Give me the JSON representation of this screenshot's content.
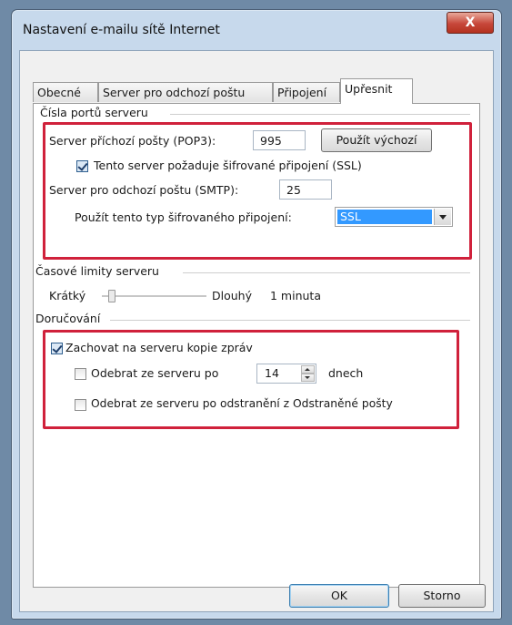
{
  "window": {
    "title": "Nastavení e-mailu sítě Internet",
    "close_label": "X"
  },
  "tabs": [
    {
      "label": "Obecné",
      "active": false
    },
    {
      "label": "Server pro odchozí poštu",
      "active": false
    },
    {
      "label": "Připojení",
      "active": false
    },
    {
      "label": "Upřesnit",
      "active": true
    }
  ],
  "ports": {
    "group_title": "Čísla portů serveru",
    "incoming_label": "Server příchozí pošty (POP3):",
    "incoming_value": "995",
    "default_button": "Použít výchozí",
    "ssl_checkbox_label": "Tento server požaduje šifrované připojení (SSL)",
    "ssl_checked": true,
    "outgoing_label": "Server pro odchozí poštu (SMTP):",
    "outgoing_value": "25",
    "encryption_label": "Použít tento typ šifrovaného připojení:",
    "encryption_value": "SSL"
  },
  "timeouts": {
    "group_title": "Časové limity serveru",
    "short_label": "Krátký",
    "long_label": "Dlouhý",
    "value_text": "1 minuta",
    "slider_level": 0.07
  },
  "delivery": {
    "group_title": "Doručování",
    "keep_copy_label": "Zachovat na serveru kopie zpráv",
    "keep_copy_checked": true,
    "remove_after_label": "Odebrat ze serveru po",
    "remove_after_checked": false,
    "remove_after_days": "14",
    "days_unit": "dnech",
    "remove_deleted_label": "Odebrat ze serveru po odstranění z Odstraněné pošty",
    "remove_deleted_checked": false
  },
  "footer": {
    "ok_label": "OK",
    "cancel_label": "Storno"
  },
  "colors": {
    "highlight_box": "#d0213b",
    "selection": "#3399ff"
  }
}
